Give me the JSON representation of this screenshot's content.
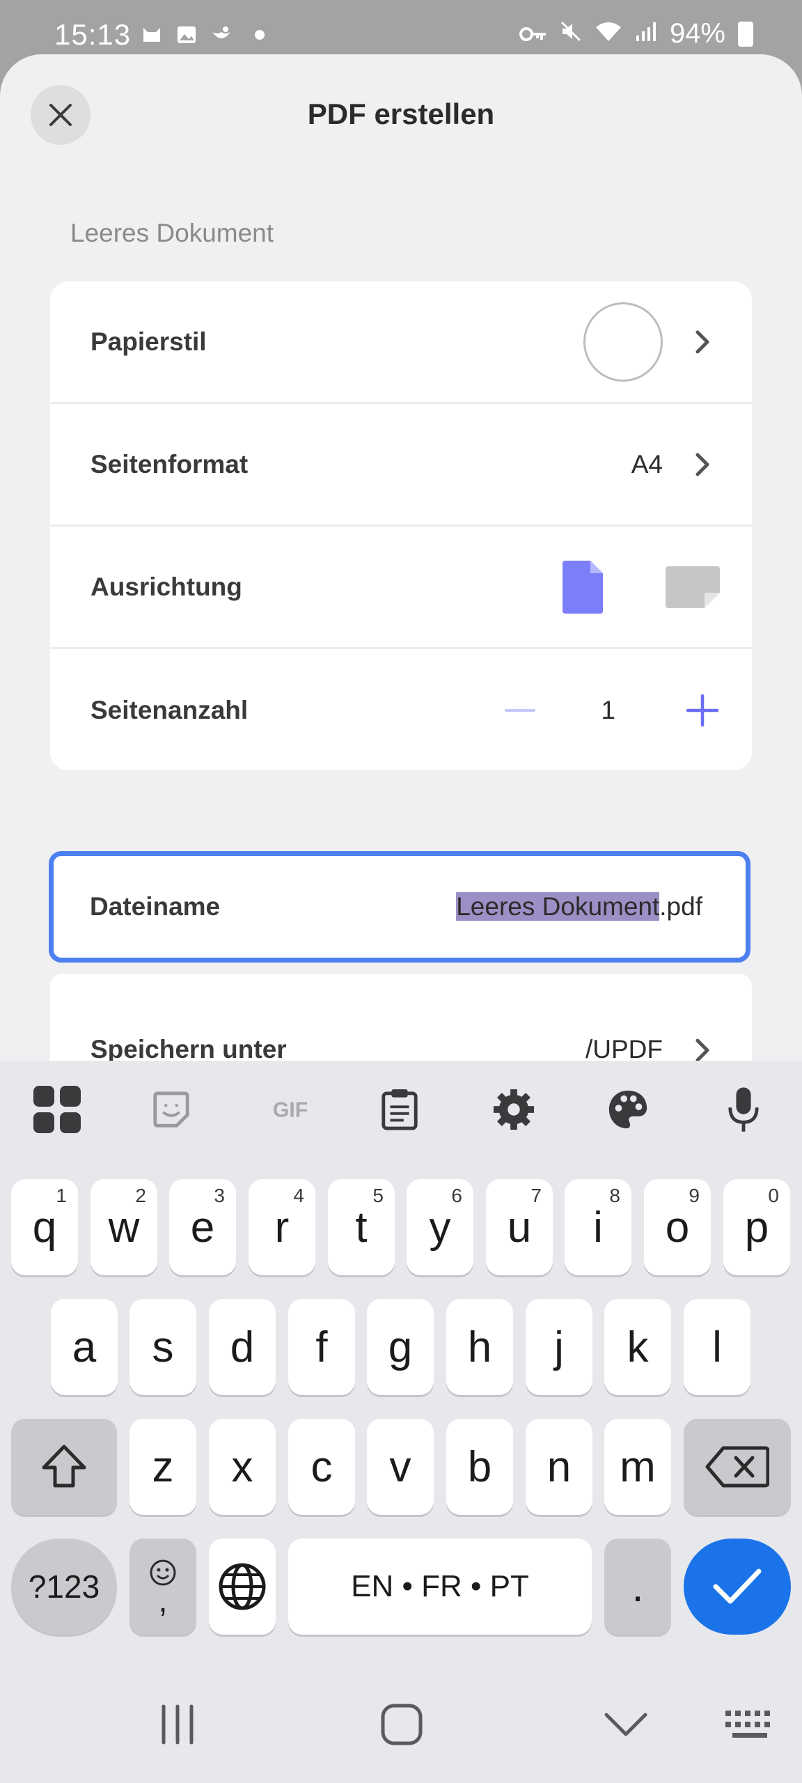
{
  "status_bar": {
    "time": "15:13",
    "battery": "94%"
  },
  "sheet": {
    "title": "PDF erstellen",
    "section_label": "Leeres Dokument",
    "rows": {
      "paper_style": {
        "label": "Papierstil"
      },
      "page_format": {
        "label": "Seitenformat",
        "value": "A4"
      },
      "orientation": {
        "label": "Ausrichtung",
        "selected": "portrait"
      },
      "page_count": {
        "label": "Seitenanzahl",
        "value": "1"
      }
    },
    "filename": {
      "label": "Dateiname",
      "selected_part": "Leeres Dokument",
      "extension": ".pdf"
    },
    "save_location": {
      "label": "Speichern unter",
      "value": "/UPDF"
    }
  },
  "colors": {
    "accent": "#7b7ef8",
    "focus_border": "#4c7ff0",
    "selection": "#9c8fc5",
    "enter_key": "#1a73e8"
  },
  "keyboard": {
    "toolbar_icons": [
      "apps-grid-icon",
      "sticker-icon",
      "gif-icon",
      "clipboard-icon",
      "settings-gear-icon",
      "palette-icon",
      "microphone-icon"
    ],
    "row1": [
      {
        "key": "q",
        "hint": "1"
      },
      {
        "key": "w",
        "hint": "2"
      },
      {
        "key": "e",
        "hint": "3"
      },
      {
        "key": "r",
        "hint": "4"
      },
      {
        "key": "t",
        "hint": "5"
      },
      {
        "key": "y",
        "hint": "6"
      },
      {
        "key": "u",
        "hint": "7"
      },
      {
        "key": "i",
        "hint": "8"
      },
      {
        "key": "o",
        "hint": "9"
      },
      {
        "key": "p",
        "hint": "0"
      }
    ],
    "row2": [
      "a",
      "s",
      "d",
      "f",
      "g",
      "h",
      "j",
      "k",
      "l"
    ],
    "row3": [
      "z",
      "x",
      "c",
      "v",
      "b",
      "n",
      "m"
    ],
    "symbols_key": "?123",
    "emoji_comma_key": ",",
    "space_label": "EN • FR • PT",
    "period_key": "."
  }
}
